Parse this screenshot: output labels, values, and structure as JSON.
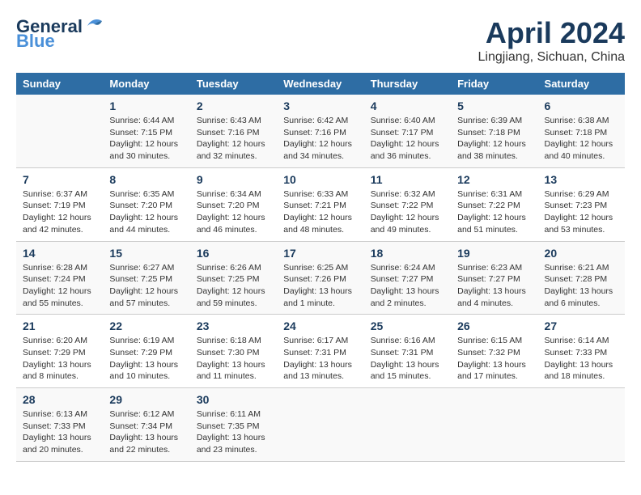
{
  "header": {
    "logo_general": "General",
    "logo_blue": "Blue",
    "month": "April 2024",
    "location": "Lingjiang, Sichuan, China"
  },
  "weekdays": [
    "Sunday",
    "Monday",
    "Tuesday",
    "Wednesday",
    "Thursday",
    "Friday",
    "Saturday"
  ],
  "weeks": [
    [
      {
        "day": "",
        "sunrise": "",
        "sunset": "",
        "daylight": ""
      },
      {
        "day": "1",
        "sunrise": "Sunrise: 6:44 AM",
        "sunset": "Sunset: 7:15 PM",
        "daylight": "Daylight: 12 hours and 30 minutes."
      },
      {
        "day": "2",
        "sunrise": "Sunrise: 6:43 AM",
        "sunset": "Sunset: 7:16 PM",
        "daylight": "Daylight: 12 hours and 32 minutes."
      },
      {
        "day": "3",
        "sunrise": "Sunrise: 6:42 AM",
        "sunset": "Sunset: 7:16 PM",
        "daylight": "Daylight: 12 hours and 34 minutes."
      },
      {
        "day": "4",
        "sunrise": "Sunrise: 6:40 AM",
        "sunset": "Sunset: 7:17 PM",
        "daylight": "Daylight: 12 hours and 36 minutes."
      },
      {
        "day": "5",
        "sunrise": "Sunrise: 6:39 AM",
        "sunset": "Sunset: 7:18 PM",
        "daylight": "Daylight: 12 hours and 38 minutes."
      },
      {
        "day": "6",
        "sunrise": "Sunrise: 6:38 AM",
        "sunset": "Sunset: 7:18 PM",
        "daylight": "Daylight: 12 hours and 40 minutes."
      }
    ],
    [
      {
        "day": "7",
        "sunrise": "Sunrise: 6:37 AM",
        "sunset": "Sunset: 7:19 PM",
        "daylight": "Daylight: 12 hours and 42 minutes."
      },
      {
        "day": "8",
        "sunrise": "Sunrise: 6:35 AM",
        "sunset": "Sunset: 7:20 PM",
        "daylight": "Daylight: 12 hours and 44 minutes."
      },
      {
        "day": "9",
        "sunrise": "Sunrise: 6:34 AM",
        "sunset": "Sunset: 7:20 PM",
        "daylight": "Daylight: 12 hours and 46 minutes."
      },
      {
        "day": "10",
        "sunrise": "Sunrise: 6:33 AM",
        "sunset": "Sunset: 7:21 PM",
        "daylight": "Daylight: 12 hours and 48 minutes."
      },
      {
        "day": "11",
        "sunrise": "Sunrise: 6:32 AM",
        "sunset": "Sunset: 7:22 PM",
        "daylight": "Daylight: 12 hours and 49 minutes."
      },
      {
        "day": "12",
        "sunrise": "Sunrise: 6:31 AM",
        "sunset": "Sunset: 7:22 PM",
        "daylight": "Daylight: 12 hours and 51 minutes."
      },
      {
        "day": "13",
        "sunrise": "Sunrise: 6:29 AM",
        "sunset": "Sunset: 7:23 PM",
        "daylight": "Daylight: 12 hours and 53 minutes."
      }
    ],
    [
      {
        "day": "14",
        "sunrise": "Sunrise: 6:28 AM",
        "sunset": "Sunset: 7:24 PM",
        "daylight": "Daylight: 12 hours and 55 minutes."
      },
      {
        "day": "15",
        "sunrise": "Sunrise: 6:27 AM",
        "sunset": "Sunset: 7:25 PM",
        "daylight": "Daylight: 12 hours and 57 minutes."
      },
      {
        "day": "16",
        "sunrise": "Sunrise: 6:26 AM",
        "sunset": "Sunset: 7:25 PM",
        "daylight": "Daylight: 12 hours and 59 minutes."
      },
      {
        "day": "17",
        "sunrise": "Sunrise: 6:25 AM",
        "sunset": "Sunset: 7:26 PM",
        "daylight": "Daylight: 13 hours and 1 minute."
      },
      {
        "day": "18",
        "sunrise": "Sunrise: 6:24 AM",
        "sunset": "Sunset: 7:27 PM",
        "daylight": "Daylight: 13 hours and 2 minutes."
      },
      {
        "day": "19",
        "sunrise": "Sunrise: 6:23 AM",
        "sunset": "Sunset: 7:27 PM",
        "daylight": "Daylight: 13 hours and 4 minutes."
      },
      {
        "day": "20",
        "sunrise": "Sunrise: 6:21 AM",
        "sunset": "Sunset: 7:28 PM",
        "daylight": "Daylight: 13 hours and 6 minutes."
      }
    ],
    [
      {
        "day": "21",
        "sunrise": "Sunrise: 6:20 AM",
        "sunset": "Sunset: 7:29 PM",
        "daylight": "Daylight: 13 hours and 8 minutes."
      },
      {
        "day": "22",
        "sunrise": "Sunrise: 6:19 AM",
        "sunset": "Sunset: 7:29 PM",
        "daylight": "Daylight: 13 hours and 10 minutes."
      },
      {
        "day": "23",
        "sunrise": "Sunrise: 6:18 AM",
        "sunset": "Sunset: 7:30 PM",
        "daylight": "Daylight: 13 hours and 11 minutes."
      },
      {
        "day": "24",
        "sunrise": "Sunrise: 6:17 AM",
        "sunset": "Sunset: 7:31 PM",
        "daylight": "Daylight: 13 hours and 13 minutes."
      },
      {
        "day": "25",
        "sunrise": "Sunrise: 6:16 AM",
        "sunset": "Sunset: 7:31 PM",
        "daylight": "Daylight: 13 hours and 15 minutes."
      },
      {
        "day": "26",
        "sunrise": "Sunrise: 6:15 AM",
        "sunset": "Sunset: 7:32 PM",
        "daylight": "Daylight: 13 hours and 17 minutes."
      },
      {
        "day": "27",
        "sunrise": "Sunrise: 6:14 AM",
        "sunset": "Sunset: 7:33 PM",
        "daylight": "Daylight: 13 hours and 18 minutes."
      }
    ],
    [
      {
        "day": "28",
        "sunrise": "Sunrise: 6:13 AM",
        "sunset": "Sunset: 7:33 PM",
        "daylight": "Daylight: 13 hours and 20 minutes."
      },
      {
        "day": "29",
        "sunrise": "Sunrise: 6:12 AM",
        "sunset": "Sunset: 7:34 PM",
        "daylight": "Daylight: 13 hours and 22 minutes."
      },
      {
        "day": "30",
        "sunrise": "Sunrise: 6:11 AM",
        "sunset": "Sunset: 7:35 PM",
        "daylight": "Daylight: 13 hours and 23 minutes."
      },
      {
        "day": "",
        "sunrise": "",
        "sunset": "",
        "daylight": ""
      },
      {
        "day": "",
        "sunrise": "",
        "sunset": "",
        "daylight": ""
      },
      {
        "day": "",
        "sunrise": "",
        "sunset": "",
        "daylight": ""
      },
      {
        "day": "",
        "sunrise": "",
        "sunset": "",
        "daylight": ""
      }
    ]
  ]
}
